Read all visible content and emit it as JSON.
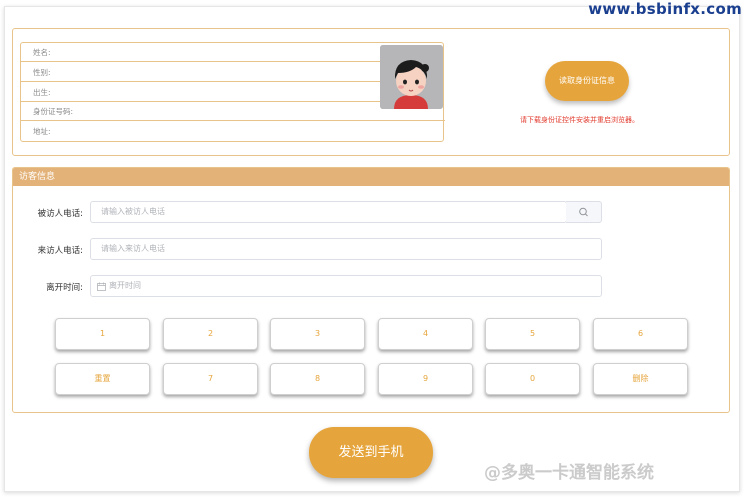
{
  "watermark_top": "www.bsbinfx.com",
  "id_card": {
    "fields": [
      {
        "label": "姓名:"
      },
      {
        "label": "性别:"
      },
      {
        "label": "出生:"
      },
      {
        "label": "身份证号码:"
      },
      {
        "label": "地址:"
      }
    ],
    "read_button": "读取身份证信息",
    "warning": "请下载身份证控件安装并重启浏览器。"
  },
  "visitor": {
    "header": "访客信息",
    "visitee_phone": {
      "label": "被访人电话:",
      "placeholder": "请输入被访人电话"
    },
    "visitor_phone": {
      "label": "来访人电话:",
      "placeholder": "请输入来访人电话"
    },
    "leave_time": {
      "label": "离开时间:",
      "placeholder": "离开时间"
    }
  },
  "keypad": {
    "row1": [
      "1",
      "2",
      "3",
      "4",
      "5",
      "6"
    ],
    "row2": [
      "重置",
      "7",
      "8",
      "9",
      "0",
      "删除"
    ]
  },
  "send_button": "发送到手机",
  "watermark_bottom": "@多奥一卡通智能系统",
  "colors": {
    "accent": "#e6a53c",
    "border": "#e9c48a",
    "header_bg": "#e3b278",
    "warning": "#e23b2e"
  }
}
